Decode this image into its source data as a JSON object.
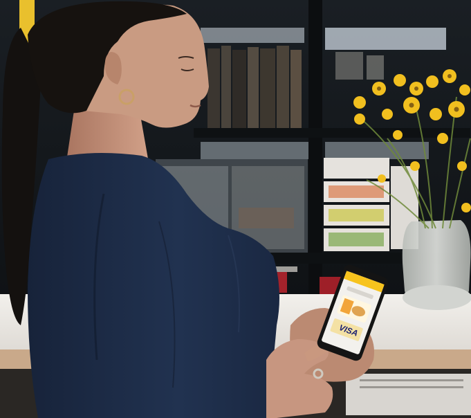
{
  "image": {
    "phone_screen": {
      "card_brand": "VISA",
      "accent_color": "#f7c31d"
    },
    "palette": {
      "shelf_dark": "#151a1f",
      "shirt_navy": "#1c2a41",
      "hair": "#14110f",
      "skin": "#c49178",
      "counter": "#ece9e4",
      "flower_yellow": "#f1bf1f"
    }
  }
}
